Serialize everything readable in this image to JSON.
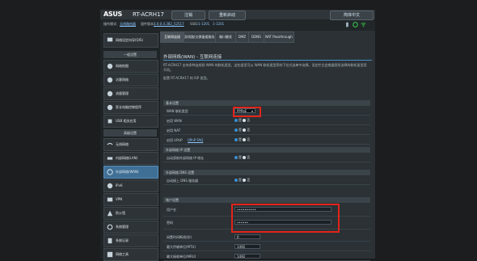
{
  "header": {
    "brand": "ASUS",
    "model": "RT-ACRH17",
    "logout_label": "注销",
    "reboot_label": "重新启动",
    "language_label": "简体中文"
  },
  "status": {
    "op_mode_label": "操作模式:",
    "op_mode_value": "无线路由器",
    "firmware_label": "固件版本:",
    "firmware_value": "3.0.0.4.382_52517",
    "ssid_label": "SSID:",
    "ssid_value_1": "1-1201",
    "ssid_value_2": "1-1201"
  },
  "sidebar": {
    "quick_setup": "网络设定向导(QIS)",
    "general_header": "一般设置",
    "general_items": [
      "网络地图",
      "访客网络",
      "流量管理",
      "家长电脑控制程序",
      "USB 相关应用"
    ],
    "advanced_header": "高级设置",
    "advanced_items": [
      "无线网络",
      "内部网络(LAN)",
      "外部网络(WAN)",
      "IPv6",
      "VPN",
      "防火墙",
      "系统管理",
      "系统记录",
      "网络工具"
    ]
  },
  "tabs": [
    "互联网连接",
    "双线路(交换备援服务)",
    "端口触发",
    "DMZ",
    "DDNS",
    "NAT Passthrough"
  ],
  "page": {
    "title": "外部网络(WAN) - 互联网连接",
    "description_1": "RT-ACRH17 支持多种连线到 WAN 的联机类型。这些类型可从 WAN 联机类型旁的下拉式选单中选择。设定栏位会根据您所选择的联机类型而不同。",
    "description_2": "配置 RT-ACRH17 的 ISP 类型。"
  },
  "sections": {
    "basic": "基本设置",
    "wan_ip": "外部网络 IP 设置",
    "wan_dns": "外部网络 DNS 设置",
    "account": "账户设置"
  },
  "fields": {
    "wan_type_label": "WAN 联机类型",
    "wan_type_value": "PPPoE",
    "enable_wan_label": "启用 WAN",
    "enable_nat_label": "启用 NAT",
    "enable_upnp_label": "启用 UPnP",
    "upnp_faq": "UPnP FAQ",
    "yes": "是",
    "no": "否",
    "auto_ip_label": "自动获取外部网络 IP 地址",
    "auto_dns_label": "自动接上 DNS 服务器",
    "username_label": "用户名",
    "username_value": "••••••••••",
    "password_label": "密码",
    "password_value": "••••••",
    "idle_label": "闲置时间断线(秒)",
    "idle_value": "0",
    "mtu_label": "最大传输单位(MTU)",
    "mtu_value": "1492",
    "mru_label": "最大接收单位(MRU)",
    "mru_value": "1492"
  },
  "colors": {
    "highlight": "#e2241b",
    "accent": "#4a90c2"
  }
}
